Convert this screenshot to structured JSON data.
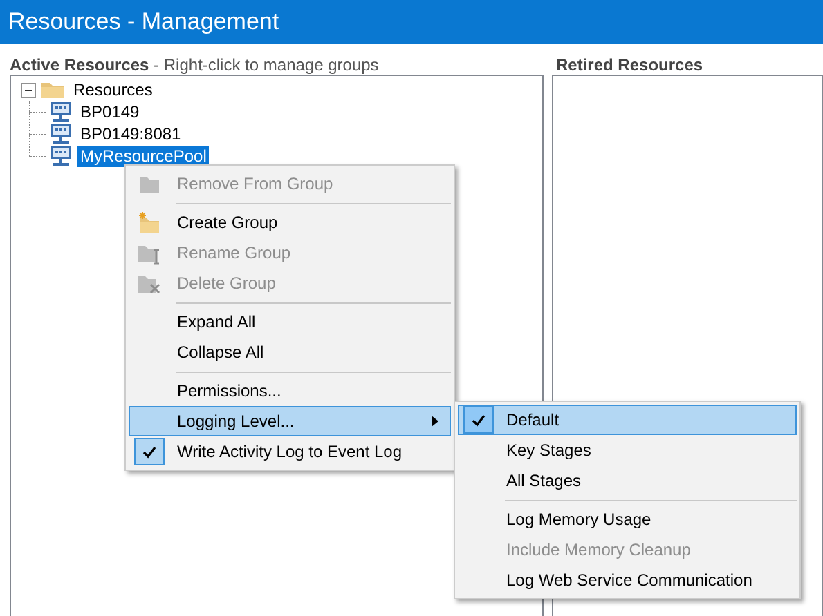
{
  "window": {
    "title": "Resources - Management"
  },
  "active_panel": {
    "title": "Active Resources",
    "hint": " - Right-click to manage groups",
    "tree": [
      {
        "label": "Resources",
        "kind": "folder",
        "expanded": true,
        "selected": false,
        "children": [
          {
            "label": "BP0149",
            "kind": "server",
            "selected": false
          },
          {
            "label": "BP0149:8081",
            "kind": "server",
            "selected": false
          },
          {
            "label": "MyResourcePool",
            "kind": "server",
            "selected": true
          }
        ]
      }
    ]
  },
  "retired_panel": {
    "title": "Retired Resources"
  },
  "context_menu": {
    "items": [
      {
        "kind": "item",
        "label": "Remove From Group",
        "disabled": true,
        "checked": false,
        "selected": false
      },
      {
        "kind": "separator"
      },
      {
        "kind": "item",
        "label": "Create Group",
        "disabled": false,
        "checked": false,
        "selected": false
      },
      {
        "kind": "item",
        "label": "Rename Group",
        "disabled": true,
        "checked": false,
        "selected": false
      },
      {
        "kind": "item",
        "label": "Delete Group",
        "disabled": true,
        "checked": false,
        "selected": false
      },
      {
        "kind": "separator"
      },
      {
        "kind": "item",
        "label": "Expand All",
        "disabled": false,
        "checked": false,
        "selected": false
      },
      {
        "kind": "item",
        "label": "Collapse All",
        "disabled": false,
        "checked": false,
        "selected": false
      },
      {
        "kind": "separator"
      },
      {
        "kind": "item",
        "label": "Permissions...",
        "disabled": false,
        "checked": false,
        "selected": false
      },
      {
        "kind": "submenu",
        "label": "Logging Level...",
        "disabled": false,
        "checked": false,
        "selected": true
      },
      {
        "kind": "item",
        "label": "Write Activity Log to Event Log",
        "disabled": false,
        "checked": true,
        "selected": false
      }
    ]
  },
  "submenu": {
    "items": [
      {
        "kind": "item",
        "label": "Default",
        "disabled": false,
        "checked": true,
        "selected": true
      },
      {
        "kind": "item",
        "label": "Key Stages",
        "disabled": false,
        "checked": false,
        "selected": false
      },
      {
        "kind": "item",
        "label": "All Stages",
        "disabled": false,
        "checked": false,
        "selected": false
      },
      {
        "kind": "separator"
      },
      {
        "kind": "item",
        "label": "Log Memory Usage",
        "disabled": false,
        "checked": false,
        "selected": false
      },
      {
        "kind": "item",
        "label": "Include Memory Cleanup",
        "disabled": true,
        "checked": false,
        "selected": false
      },
      {
        "kind": "item",
        "label": "Log Web Service Communication",
        "disabled": false,
        "checked": false,
        "selected": false
      }
    ]
  }
}
